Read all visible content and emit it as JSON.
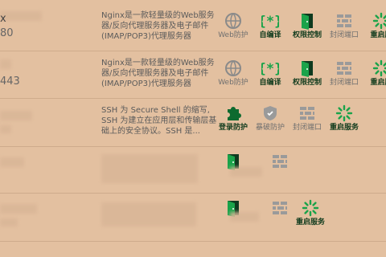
{
  "rows": [
    {
      "name": "x",
      "port": "80",
      "desc": "Nginx是一款轻量级的Web服务器/反向代理服务器及电子邮件(IMAP/POP3)代理服务器",
      "actions": [
        {
          "label": "Web防护",
          "icon": "globe-icon",
          "state": "off"
        },
        {
          "label": "自编译",
          "icon": "braces-icon",
          "state": "on"
        },
        {
          "label": "权限控制",
          "icon": "door-icon",
          "state": "on"
        },
        {
          "label": "封闭端口",
          "icon": "brick-wall-icon",
          "state": "off"
        },
        {
          "label": "重启服",
          "icon": "spinner-icon",
          "state": "on"
        }
      ]
    },
    {
      "name": "",
      "port": "443",
      "desc": "Nginx是一款轻量级的Web服务器/反向代理服务器及电子邮件(IMAP/POP3)代理服务器",
      "actions": [
        {
          "label": "Web防护",
          "icon": "globe-icon",
          "state": "off"
        },
        {
          "label": "自编译",
          "icon": "braces-icon",
          "state": "on"
        },
        {
          "label": "权限控制",
          "icon": "door-icon",
          "state": "on"
        },
        {
          "label": "封闭端口",
          "icon": "brick-wall-icon",
          "state": "off"
        },
        {
          "label": "重启服",
          "icon": "spinner-icon",
          "state": "on"
        }
      ]
    },
    {
      "desc": "SSH 为 Secure Shell 的缩写, SSH 为建立在应用层和传输层基础上的安全协议。SSH 是...",
      "actions": [
        {
          "label": "登录防护",
          "icon": "puzzle-icon",
          "state": "on"
        },
        {
          "label": "暴破防护",
          "icon": "shield-icon",
          "state": "off"
        },
        {
          "label": "封闭端口",
          "icon": "brick-wall-icon",
          "state": "off"
        },
        {
          "label": "重启服务",
          "icon": "spinner-icon",
          "state": "on"
        }
      ]
    },
    {
      "actions": [
        {
          "label": "",
          "icon": "door-icon",
          "state": "on"
        },
        {
          "label": "",
          "icon": "brick-wall-icon",
          "state": "off"
        }
      ]
    },
    {
      "actions": [
        {
          "label": "",
          "icon": "door-icon",
          "state": "on"
        },
        {
          "label": "",
          "icon": "brick-wall-icon",
          "state": "off"
        },
        {
          "label": "重启服务",
          "icon": "spinner-icon",
          "state": "on"
        }
      ]
    }
  ],
  "colors": {
    "accent": "#1aa34a",
    "dark": "#0e3a1f",
    "muted": "#7a7a7a"
  }
}
